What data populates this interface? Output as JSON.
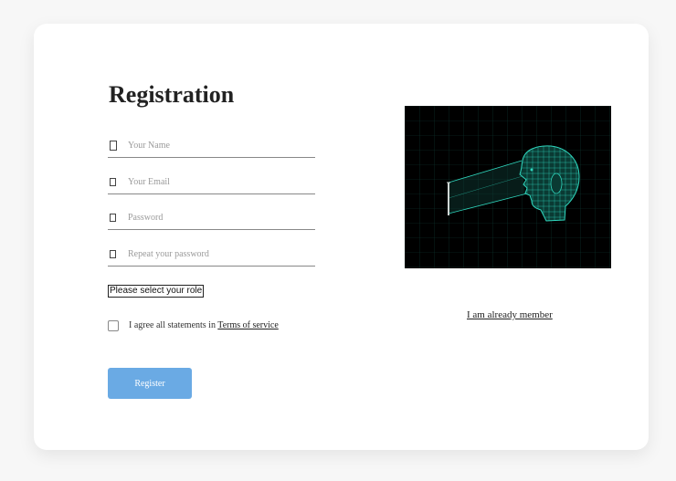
{
  "form": {
    "title": "Registration",
    "fields": [
      {
        "name": "name",
        "placeholder": "Your Name",
        "value": ""
      },
      {
        "name": "email",
        "placeholder": "Your Email",
        "value": ""
      },
      {
        "name": "password",
        "placeholder": "Password",
        "value": ""
      },
      {
        "name": "repeat_password",
        "placeholder": "Repeat your password",
        "value": ""
      }
    ],
    "role_select": {
      "selected": "Please select your role"
    },
    "agree": {
      "checked": false,
      "text": "I agree all statements in",
      "link_text": "Terms of service"
    },
    "register_label": "Register"
  },
  "side": {
    "image_icon": "wireframe-head-scan",
    "member_link": "I am already member"
  },
  "colors": {
    "page_background": "#f7f7f7",
    "card_background": "#ffffff",
    "button": "#6aaae4",
    "image_background": "#000000",
    "wireframe": "#1fb5a0"
  }
}
